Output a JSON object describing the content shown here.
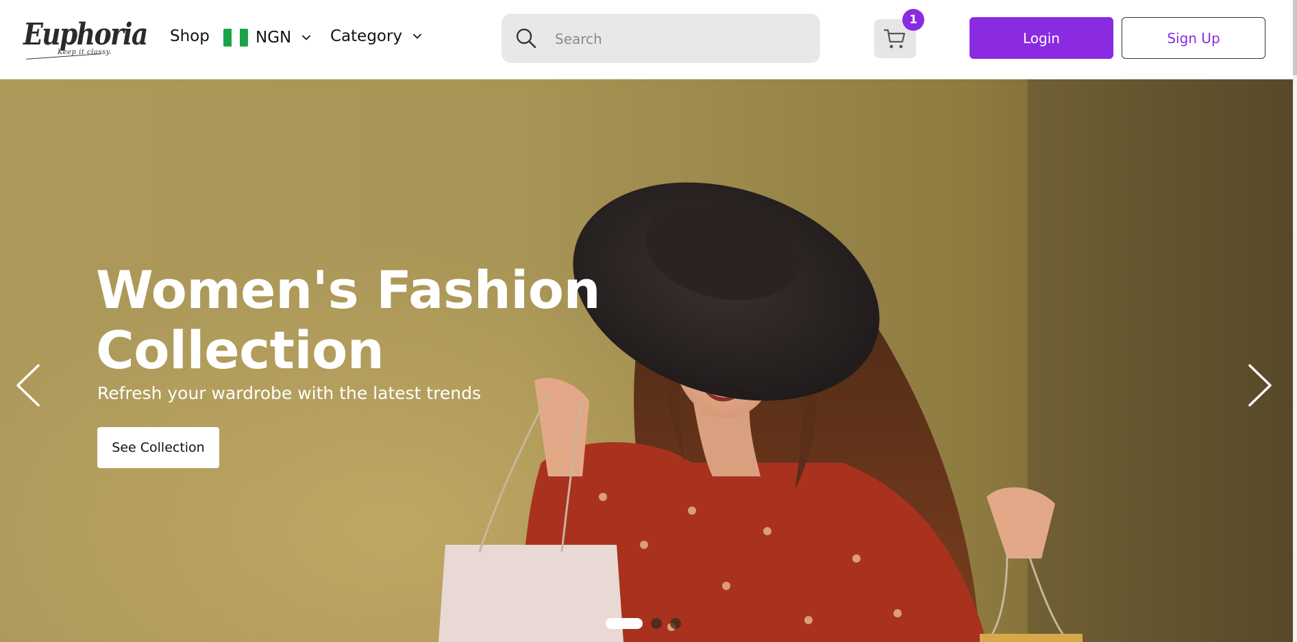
{
  "header": {
    "logo": {
      "name": "Euphoria",
      "tagline": "Keep it classy."
    },
    "nav": {
      "shop_label": "Shop",
      "currency_label": "NGN",
      "category_label": "Category"
    },
    "search": {
      "placeholder": "Search",
      "value": ""
    },
    "cart": {
      "count": "1"
    },
    "login_label": "Login",
    "signup_label": "Sign Up"
  },
  "hero": {
    "title": "Women's Fashion Collection",
    "subtitle": "Refresh your wardrobe with the latest trends",
    "cta_label": "See Collection",
    "slides_total": 3,
    "active_slide": 1
  },
  "colors": {
    "accent": "#8a2be2",
    "hero_background": "#a89555",
    "search_background": "#e8e8e8"
  },
  "icons": [
    "search-icon",
    "cart-icon",
    "chevron-down-icon",
    "arrow-left-icon",
    "arrow-right-icon",
    "nigeria-flag-icon"
  ]
}
